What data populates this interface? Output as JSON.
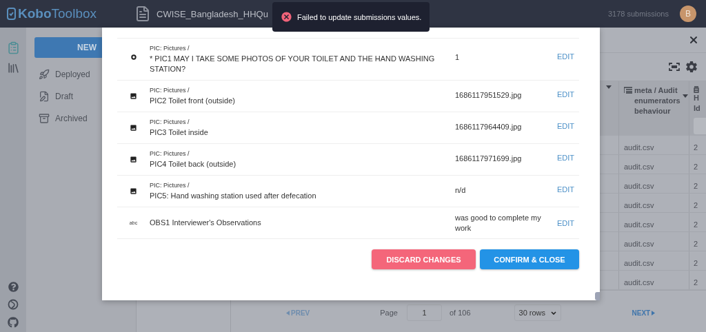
{
  "header": {
    "logo_bold": "Kobo",
    "logo_light": "Toolbox",
    "form_title": "CWISE_Bangladesh_HHQu",
    "submissions": "3178 submissions",
    "avatar": "B"
  },
  "sidebar": {
    "new_button": "NEW",
    "items": [
      {
        "kind": "deployed",
        "label": "Deployed"
      },
      {
        "kind": "draft",
        "label": "Draft"
      },
      {
        "kind": "archived",
        "label": "Archived"
      }
    ]
  },
  "table": {
    "column_2": "meta / Audit enumerators behaviour",
    "column_3": [
      "H",
      "Id"
    ],
    "rows": [
      {
        "column_2": "audit.csv",
        "column_3": "2"
      },
      {
        "column_2": "audit.csv",
        "column_3": "2"
      },
      {
        "column_2": "audit.csv",
        "column_3": "2"
      },
      {
        "column_2": "audit.csv",
        "column_3": "2"
      },
      {
        "column_2": "audit.csv",
        "column_3": "2"
      },
      {
        "column_2": "audit.csv",
        "column_3": "2"
      },
      {
        "column_2": "audit.csv",
        "column_3": "2"
      },
      {
        "column_2": "audit.csv",
        "column_3": "2"
      }
    ]
  },
  "pager": {
    "prev": "PREV",
    "page_label": "Page",
    "page": "1",
    "of": "of 106",
    "rows": "30 rows",
    "next": "NEXT"
  },
  "modal": {
    "rows": [
      {
        "kind": "select_one",
        "group": "PIC: Pictures /",
        "question": "* PIC1 MAY I TAKE SOME PHOTOS OF YOUR TOILET AND THE HAND WASHING STATION?",
        "value": "1",
        "action": "EDIT"
      },
      {
        "kind": "image",
        "group": "PIC: Pictures /",
        "question": "PIC2 Toilet front (outside)",
        "value": "1686117951529.jpg",
        "action": "EDIT"
      },
      {
        "kind": "image",
        "group": "PIC: Pictures /",
        "question": "PIC3 Toilet inside",
        "value": "1686117964409.jpg",
        "action": "EDIT"
      },
      {
        "kind": "image",
        "group": "PIC: Pictures /",
        "question": "PIC4 Toilet back (outside)",
        "value": "1686117971699.jpg",
        "action": "EDIT"
      },
      {
        "kind": "image",
        "group": "PIC: Pictures /",
        "question": "PIC5: Hand washing station used after defecation",
        "value": "n/d",
        "action": "EDIT"
      },
      {
        "kind": "text",
        "type_icon": "abc",
        "question": "OBS1 Interviewer's Observations",
        "value": "was good to complete my work",
        "action": "EDIT"
      }
    ],
    "buttons": [
      {
        "kind": "discard",
        "label": "DISCARD CHANGES"
      },
      {
        "kind": "confirm",
        "label": "CONFIRM & CLOSE"
      }
    ]
  },
  "toast": {
    "kind": "error",
    "message": "Failed to update submissions values."
  }
}
